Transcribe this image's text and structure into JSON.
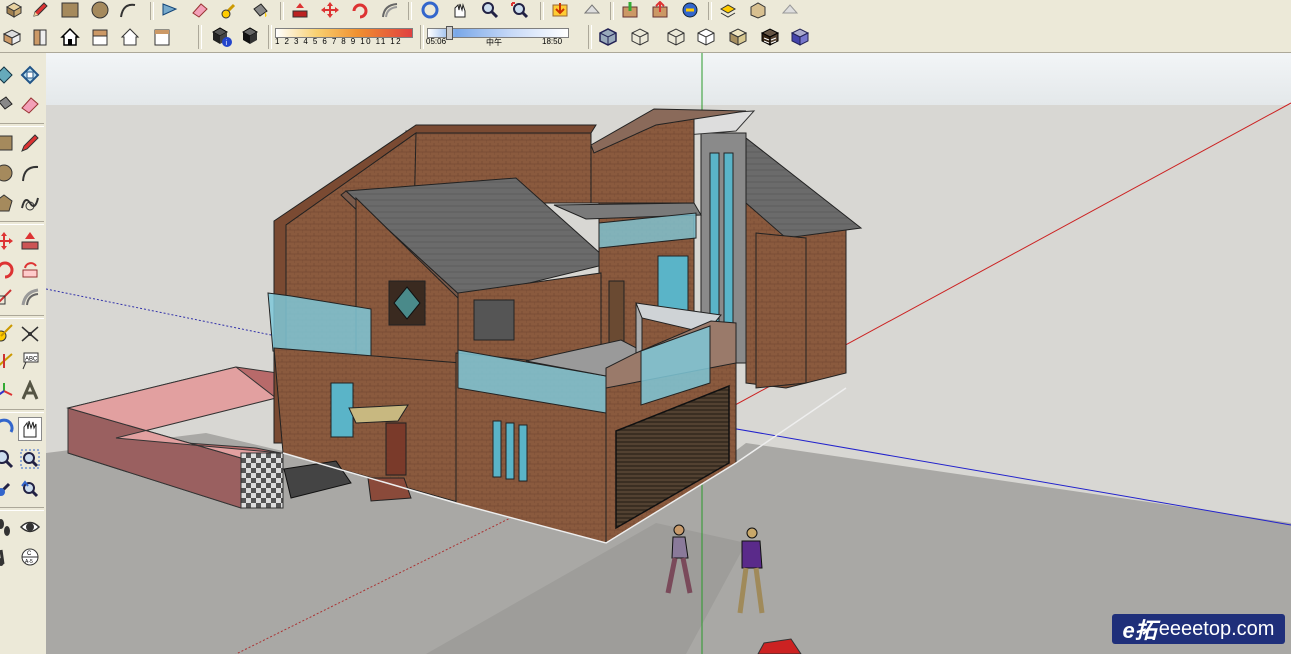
{
  "toolbar_top": {
    "icons": [
      "pencil-icon",
      "rectangle-icon",
      "circle-icon",
      "arc-icon",
      "eraser-icon",
      "paint-bucket-icon",
      "tape-measure-icon",
      "move-icon",
      "push-pull-icon",
      "rotate-icon",
      "follow-me-icon",
      "offset-icon",
      "orbit-icon",
      "pan-icon",
      "zoom-icon",
      "zoom-extents-icon",
      "get-models-icon",
      "share-model-icon",
      "warehouse-icon",
      "upload-icon",
      "component-icon",
      "layer-icon"
    ]
  },
  "toolbar_views": {
    "icons": [
      "iso-view-icon",
      "front-view-icon",
      "top-house-icon",
      "back-view-icon",
      "right-view-icon",
      "left-view-icon"
    ]
  },
  "toolbar_shadow": {
    "icons": [
      "shadow-settings-icon",
      "display-shadows-icon"
    ],
    "month_ticks": "1 2 3 4 5 6 7 8 9 10 11 12",
    "time_start": "05:06",
    "time_mid": "中午",
    "time_end": "18:50"
  },
  "toolbar_styles": {
    "icons": [
      "xray-icon",
      "back-edges-icon",
      "wireframe-icon",
      "hidden-line-icon",
      "shaded-icon",
      "shaded-textures-icon",
      "monochrome-icon"
    ]
  },
  "left_toolbar": {
    "icons": [
      "select-icon",
      "make-component-icon",
      "paint-bucket-icon",
      "eraser-icon",
      "rectangle-icon",
      "pencil-icon",
      "circle-icon",
      "arc-icon",
      "polygon-icon",
      "freehand-icon",
      "move-icon",
      "push-pull-icon",
      "rotate-icon",
      "follow-me-icon",
      "scale-icon",
      "offset-icon",
      "tape-measure-icon",
      "dimension-icon",
      "protractor-icon",
      "text-icon",
      "axes-icon",
      "3d-text-icon",
      "orbit-icon",
      "pan-icon",
      "zoom-icon",
      "zoom-window-icon",
      "previous-view-icon",
      "zoom-extents-icon",
      "walk-icon",
      "look-around-icon",
      "position-camera-icon",
      "section-plane-icon"
    ]
  },
  "watermark": {
    "logo": "e拓",
    "text": "eeeetop.com"
  }
}
